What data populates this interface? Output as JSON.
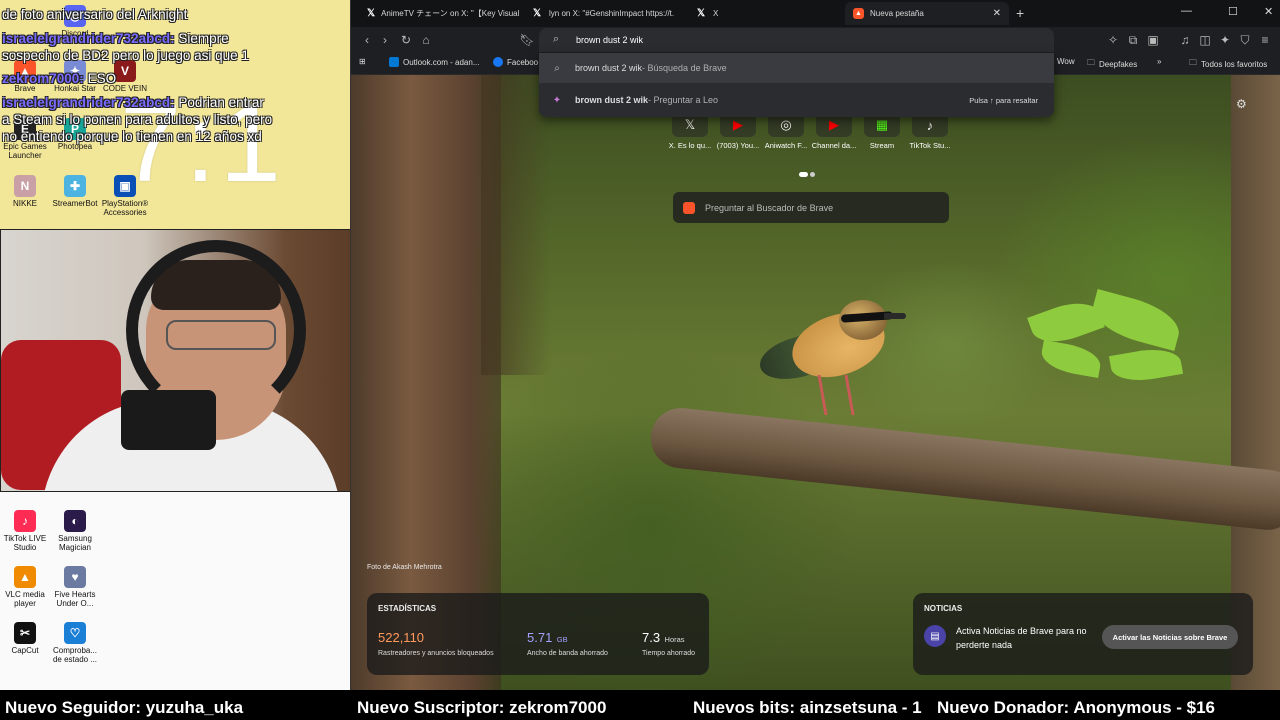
{
  "desktop": {
    "clock": "7:1",
    "icons": [
      {
        "name": "Discord",
        "color": "#5865f2",
        "glyph": "◉"
      },
      {
        "name": "Brave",
        "color": "#fb542b",
        "glyph": "▲"
      },
      {
        "name": "Honkai Star",
        "color": "#7a8bd6",
        "glyph": "✦"
      },
      {
        "name": "CODE VEIN",
        "color": "#8b1a1a",
        "glyph": "V"
      },
      {
        "name": "Epic Games Launcher",
        "color": "#222222",
        "glyph": "E"
      },
      {
        "name": "Photopea",
        "color": "#18a497",
        "glyph": "P"
      },
      {
        "name": "NIKKE",
        "color": "#c9a0a6",
        "glyph": "N"
      },
      {
        "name": "StreamerBot",
        "color": "#4db3e0",
        "glyph": "✚"
      },
      {
        "name": "PlayStation® Accessories",
        "color": "#0a4fb5",
        "glyph": "▣"
      },
      {
        "name": "TikTok LIVE Studio",
        "color": "#fe2c55",
        "glyph": "♪"
      },
      {
        "name": "Samsung Magician",
        "color": "#2b1b4b",
        "glyph": "◐"
      },
      {
        "name": "VLC media player",
        "color": "#f08a00",
        "glyph": "▲"
      },
      {
        "name": "Five Hearts Under O...",
        "color": "#6b7aa0",
        "glyph": "♥"
      },
      {
        "name": "CapCut",
        "color": "#111111",
        "glyph": "✂"
      },
      {
        "name": "Comproba... de estado ...",
        "color": "#1b7fd6",
        "glyph": "♡"
      }
    ],
    "chat": [
      {
        "user": "",
        "text": "de foto aniversario del Arknight"
      },
      {
        "user": "israelelgrandrider732abcd:",
        "text": "Siempre"
      },
      {
        "user": "",
        "text": "sospecho de BD2 pero lo juego asi que 1"
      },
      {
        "user": "zekrom7000:",
        "text": "ESO"
      },
      {
        "user": "israelelgrandrider732abcd:",
        "text": "Podrian entrar"
      },
      {
        "user": "",
        "text": "a Steam si lo ponen para adultos y listo, pero"
      },
      {
        "user": "",
        "text": "no entiendo porque lo tienen en 12 años xd"
      }
    ]
  },
  "browser": {
    "tabs": [
      {
        "label": "AnimeTV チェーン on X: \"【Key Visual】",
        "icon": "X"
      },
      {
        "label": "lyn on X: \"#GenshinImpact https://t.",
        "icon": "X"
      },
      {
        "label": "X",
        "icon": "X"
      },
      {
        "label": "Nueva pestaña",
        "icon": "brave"
      }
    ],
    "address_value": "brown dust 2 wik",
    "bookmarks": [
      {
        "label": "Outlook.com - adan...",
        "color": "#0078d4"
      },
      {
        "label": "Faceboo",
        "color": "#1877f2"
      },
      {
        "label": "Wow",
        "color": ""
      },
      {
        "label": "Deepfakes",
        "color": ""
      },
      {
        "label": "Todos los favoritos",
        "color": ""
      }
    ],
    "suggestions": [
      {
        "strong": "brown dust 2 wik",
        "muted": " - Búsqueda de Brave",
        "hint": ""
      },
      {
        "strong": "brown dust 2 wik",
        "muted": " - Preguntar a Leo",
        "hint": "Pulsa ↑ para resaltar"
      }
    ],
    "newtab": {
      "quick_links": [
        {
          "label": "X. Es lo qu...",
          "glyph": "X"
        },
        {
          "label": "(7003) You...",
          "glyph": "▶"
        },
        {
          "label": "Aniwatch F...",
          "glyph": "◎"
        },
        {
          "label": "Channel da...",
          "glyph": "▶"
        },
        {
          "label": "Stream",
          "glyph": "▦"
        },
        {
          "label": "TikTok Stu...",
          "glyph": "♪"
        }
      ],
      "search_placeholder": "Preguntar al Buscador de Brave",
      "photo_credit": "Foto de Akash Mehrotra",
      "stats": {
        "title": "ESTADÍSTICAS",
        "items": [
          {
            "value": "522,110",
            "unit": "",
            "label": "Rastreadores y anuncios bloqueados",
            "color": "#ff9a5a"
          },
          {
            "value": "5.71",
            "unit": "GB",
            "label": "Ancho de banda ahorrado",
            "color": "#a4a2ff"
          },
          {
            "value": "7.3",
            "unit": "Horas",
            "label": "Tiempo ahorrado",
            "color": "#ffffff"
          }
        ]
      },
      "news": {
        "title": "NOTICIAS",
        "text": "Activa Noticias de Brave para no perderte nada",
        "button": "Activar las Noticias sobre Brave"
      }
    }
  },
  "ticker": [
    "Nuevo Seguidor: yuzuha_uka",
    "Nuevo Suscriptor: zekrom7000",
    "Nuevos bits: ainzsetsuna - 1",
    "Nuevo Donador: Anonymous - $16"
  ]
}
